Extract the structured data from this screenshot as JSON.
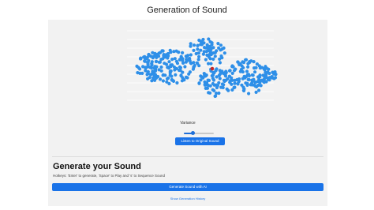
{
  "page": {
    "title": "Generation of Sound"
  },
  "visualization": {
    "dot_color": "#2e8fe8",
    "selected_dot_color": "#c62828",
    "grid_color": "#ffffff"
  },
  "controls": {
    "variance_label": "Variance",
    "variance_value": 0.3,
    "listen_button": "Listen to Original Sound"
  },
  "generate": {
    "heading": "Generate your Sound",
    "hotkeys": "Hotkeys: 'Enter' to generate, 'Space' to Play and 's' to Sequence Sound",
    "button": "Generate Sound with AI",
    "history_link": "Show Generation History"
  },
  "colors": {
    "accent": "#1a73e8",
    "panel_bg": "#f2f2f2"
  }
}
